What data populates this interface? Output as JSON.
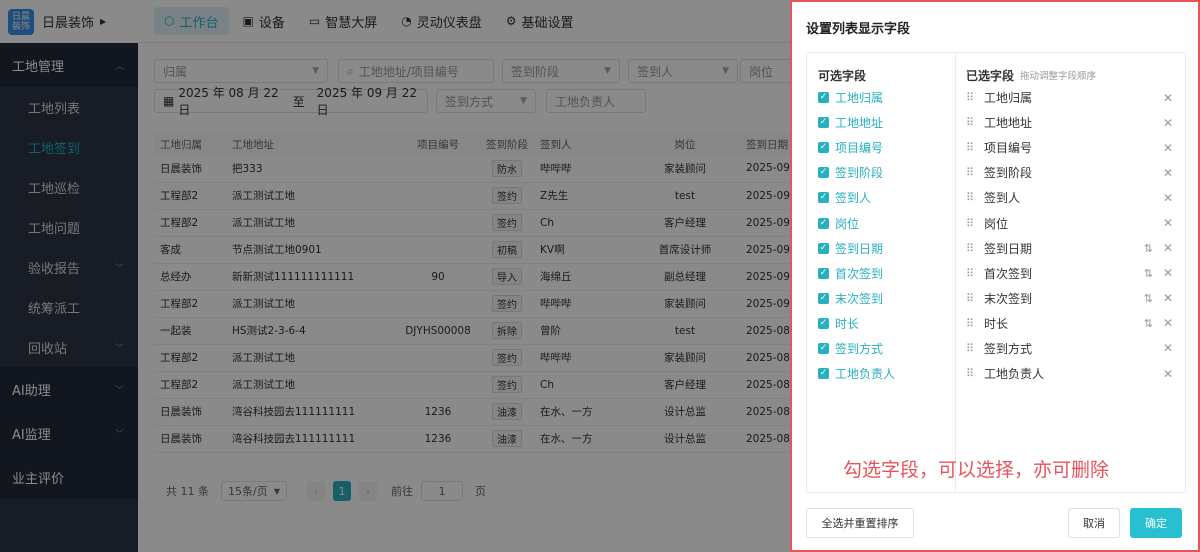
{
  "app": {
    "logo_text": "日晨\n装饰",
    "name": "日晨装饰"
  },
  "sidebar": {
    "groups": [
      {
        "label": "工地管理",
        "expanded": true
      },
      {
        "label": "AI助理"
      },
      {
        "label": "AI监理"
      },
      {
        "label": "业主评价"
      }
    ],
    "items": [
      {
        "label": "工地列表"
      },
      {
        "label": "工地签到",
        "active": true
      },
      {
        "label": "工地巡检"
      },
      {
        "label": "工地问题"
      },
      {
        "label": "验收报告"
      },
      {
        "label": "统筹派工"
      },
      {
        "label": "回收站"
      }
    ]
  },
  "topnav": [
    {
      "label": "工作台",
      "icon": "cube-icon",
      "active": true
    },
    {
      "label": "设备",
      "icon": "device-icon"
    },
    {
      "label": "智慧大屏",
      "icon": "monitor-icon"
    },
    {
      "label": "灵动仪表盘",
      "icon": "gauge-icon"
    },
    {
      "label": "基础设置",
      "icon": "gear-icon"
    }
  ],
  "filters": {
    "belong": "归属",
    "address_placeholder": "工地地址/项目编号",
    "stage": "签到阶段",
    "person": "签到人",
    "position": "岗位",
    "date_start": "2025 年 08 月 22 日",
    "date_sep": "至",
    "date_end": "2025 年 09 月 22 日",
    "method": "签到方式",
    "manager": "工地负责人"
  },
  "table": {
    "headers": [
      "工地归属",
      "工地地址",
      "项目编号",
      "签到阶段",
      "签到人",
      "岗位",
      "签到日期"
    ],
    "rows": [
      [
        "日晨装饰",
        "把333",
        "",
        "防水",
        "哔哔哔",
        "家装顾问",
        "2025-09"
      ],
      [
        "工程部2",
        "派工测试工地",
        "",
        "签约",
        "Z先生",
        "test",
        "2025-09"
      ],
      [
        "工程部2",
        "派工测试工地",
        "",
        "签约",
        "Ch",
        "客户经理",
        "2025-09"
      ],
      [
        "客成",
        "节点测试工地0901",
        "",
        "初稿",
        "KV啊",
        "首席设计师",
        "2025-09"
      ],
      [
        "总经办",
        "新新测试111111111111",
        "90",
        "导入",
        "海绵丘",
        "副总经理",
        "2025-09"
      ],
      [
        "工程部2",
        "派工测试工地",
        "",
        "签约",
        "哔哔哔",
        "家装顾问",
        "2025-09"
      ],
      [
        "一起装",
        "HS测试2-3-6-4",
        "DJYHS00008",
        "拆除",
        "曾阶",
        "test",
        "2025-08"
      ],
      [
        "工程部2",
        "派工测试工地",
        "",
        "签约",
        "哔哔哔",
        "家装顾问",
        "2025-08"
      ],
      [
        "工程部2",
        "派工测试工地",
        "",
        "签约",
        "Ch",
        "客户经理",
        "2025-08"
      ],
      [
        "日晨装饰",
        "湾谷科技园去111111111",
        "1236",
        "油漆",
        "在水、一方",
        "设计总监",
        "2025-08"
      ],
      [
        "日晨装饰",
        "湾谷科技园去111111111",
        "1236",
        "油漆",
        "在水、一方",
        "设计总监",
        "2025-08"
      ]
    ]
  },
  "pager": {
    "total": "共 11 条",
    "page_size": "15条/页",
    "current": "1",
    "goto_label": "前往",
    "goto_value": "1",
    "page_unit": "页"
  },
  "dialog": {
    "title": "设置列表显示字段",
    "available_title": "可选字段",
    "selected_title": "已选字段",
    "selected_hint": "拖动调整字段顺序",
    "available": [
      "工地归属",
      "工地地址",
      "项目编号",
      "签到阶段",
      "签到人",
      "岗位",
      "签到日期",
      "首次签到",
      "末次签到",
      "时长",
      "签到方式",
      "工地负责人"
    ],
    "selected": [
      {
        "label": "工地归属",
        "sortable": false
      },
      {
        "label": "工地地址",
        "sortable": false
      },
      {
        "label": "项目编号",
        "sortable": false
      },
      {
        "label": "签到阶段",
        "sortable": false
      },
      {
        "label": "签到人",
        "sortable": false
      },
      {
        "label": "岗位",
        "sortable": false
      },
      {
        "label": "签到日期",
        "sortable": true
      },
      {
        "label": "首次签到",
        "sortable": true
      },
      {
        "label": "末次签到",
        "sortable": true
      },
      {
        "label": "时长",
        "sortable": true
      },
      {
        "label": "签到方式",
        "sortable": false
      },
      {
        "label": "工地负责人",
        "sortable": false
      }
    ],
    "annotation": "勾选字段，可以选择，亦可删除",
    "select_all_label": "全选并重置排序",
    "cancel_label": "取消",
    "confirm_label": "确定"
  },
  "colors": {
    "accent": "#27b0c0",
    "annotation": "#e8545a",
    "sidebar": "#2b3445"
  }
}
